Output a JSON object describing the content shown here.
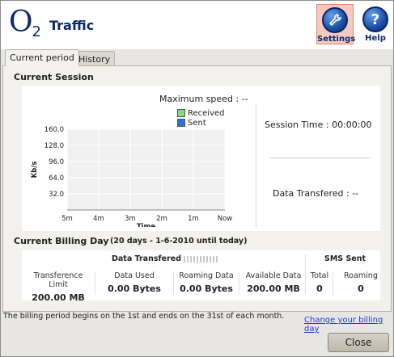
{
  "header": {
    "logo_text": "O",
    "logo_sub": "2",
    "title": "Traffic",
    "settings_label": "Settings",
    "help_label": "Help",
    "help_glyph": "?"
  },
  "tabs": [
    {
      "label": "Current period",
      "active": true
    },
    {
      "label": "History",
      "active": false
    }
  ],
  "current_session": {
    "title": "Current Session",
    "max_speed": "Maximum speed : --",
    "legend": [
      {
        "label": "Received",
        "color": "#7fdc7f"
      },
      {
        "label": "Sent",
        "color": "#2f6fd6"
      }
    ],
    "session_time": "Session Time :  00:00:00",
    "data_transfered": "Data Transfered :  --"
  },
  "chart_data": {
    "type": "line",
    "ylabel": "Kb/s",
    "xlabel": "Time",
    "yticks": [
      "160.0",
      "128.0",
      "96.0",
      "64.0",
      "32.0"
    ],
    "ytick_values": [
      160,
      128,
      96,
      64,
      32
    ],
    "xticks": [
      "5m",
      "4m",
      "3m",
      "2m",
      "1m",
      "Now"
    ],
    "ylim": [
      0,
      160
    ],
    "grid": true,
    "series": [
      {
        "name": "Received",
        "values": []
      },
      {
        "name": "Sent",
        "values": []
      }
    ]
  },
  "billing": {
    "title": "Current Billing Day",
    "subtitle": "(20 days - 1-6-2010 until today)",
    "data_transfered_header": "Data Transfered",
    "sms_header": "SMS Sent",
    "stats": [
      {
        "key": "Transference Limit",
        "value": "200.00 MB"
      },
      {
        "key": "Data Used",
        "value": "0.00 Bytes"
      },
      {
        "key": "Roaming Data",
        "value": "0.00 Bytes"
      },
      {
        "key": "Available Data",
        "value": "200.00 MB"
      },
      {
        "key": "Total",
        "value": "0"
      },
      {
        "key": "Roaming",
        "value": "0"
      }
    ]
  },
  "footer": {
    "note": "The billing period begins on the 1st and ends on the 31st of each month.",
    "link": "Change your billing day",
    "close_label": "Close"
  }
}
